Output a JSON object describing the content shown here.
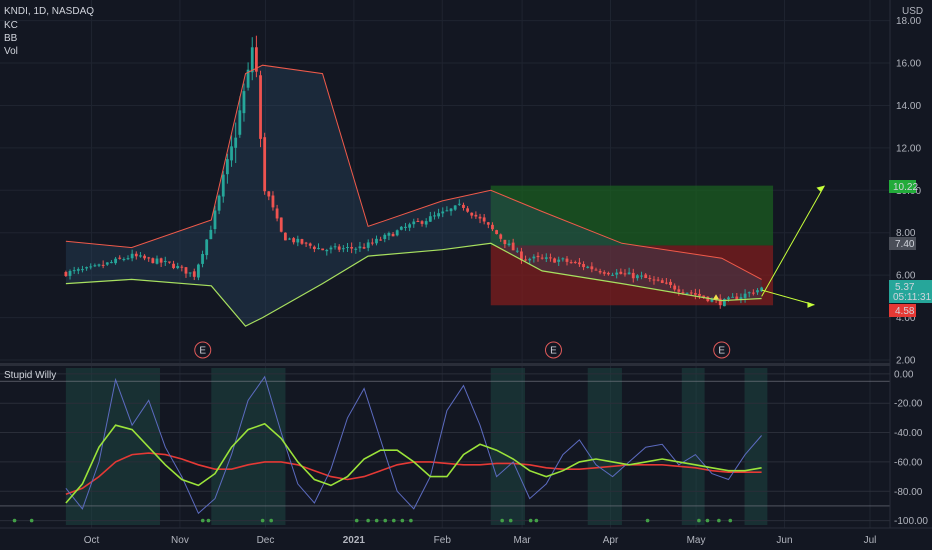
{
  "header": {
    "symbol_line": "KNDI, 1D, NASDAQ",
    "indicators": [
      "KC",
      "BB",
      "Vol"
    ],
    "currency": "USD"
  },
  "colors": {
    "background": "#131722",
    "up": "#26a69a",
    "down": "#ef5350",
    "upper_band": "#f05a4a",
    "lower_band": "#a8e05f",
    "profit_zone": "#1b5e20",
    "loss_zone": "#7f1d1d",
    "osc_line": "#5c6bc0",
    "osc_signal": "#9be33a",
    "osc_ma": "#e53935",
    "projection": "#c6ff3a"
  },
  "price_labels": {
    "target": "10.22",
    "entry": "7.40",
    "current": "5.37",
    "countdown": "05:11:31",
    "stop": "4.58"
  },
  "earnings_marker": "E",
  "oscillator": {
    "title": "Stupid Willy"
  },
  "chart_data": [
    {
      "type": "candlestick",
      "title": "KNDI, 1D, NASDAQ",
      "x_ticks": [
        "Oct",
        "Nov",
        "Dec",
        "2021",
        "Feb",
        "Mar",
        "Apr",
        "May",
        "Jun",
        "Jul"
      ],
      "y_ticks": [
        "2.00",
        "4.00",
        "6.00",
        "8.00",
        "10.00",
        "12.00",
        "14.00",
        "16.00",
        "18.00"
      ],
      "ylim": [
        2,
        18.5
      ],
      "key_points": [
        {
          "date": "Sep 22",
          "close": 6.1
        },
        {
          "date": "Oct 1",
          "close": 6.3
        },
        {
          "date": "Oct 15",
          "close": 6.9
        },
        {
          "date": "Oct 29",
          "close": 6.5
        },
        {
          "date": "Nov 6",
          "close": 6.0
        },
        {
          "date": "Nov 12",
          "close": 8.3
        },
        {
          "date": "Nov 19",
          "close": 11.8
        },
        {
          "date": "Nov 25",
          "close": 15.5
        },
        {
          "date": "Nov 27",
          "close": 17.4
        },
        {
          "date": "Nov 30",
          "close": 10.5
        },
        {
          "date": "Dec 7",
          "close": 7.8
        },
        {
          "date": "Dec 21",
          "close": 7.2
        },
        {
          "date": "Jan 4",
          "close": 7.3
        },
        {
          "date": "Jan 20",
          "close": 8.3
        },
        {
          "date": "Feb 1",
          "close": 8.9
        },
        {
          "date": "Feb 8",
          "close": 9.3
        },
        {
          "date": "Feb 18",
          "close": 8.2
        },
        {
          "date": "Mar 1",
          "close": 6.8
        },
        {
          "date": "Mar 15",
          "close": 6.7
        },
        {
          "date": "Mar 29",
          "close": 6.2
        },
        {
          "date": "Apr 12",
          "close": 5.9
        },
        {
          "date": "Apr 26",
          "close": 5.3
        },
        {
          "date": "May 10",
          "close": 4.7
        },
        {
          "date": "May 24",
          "close": 5.37
        }
      ],
      "upper_band": [
        {
          "date": "Sep 22",
          "value": 7.6
        },
        {
          "date": "Oct 15",
          "value": 7.3
        },
        {
          "date": "Nov 12",
          "value": 8.6
        },
        {
          "date": "Nov 24",
          "value": 15.5
        },
        {
          "date": "Nov 30",
          "value": 15.9
        },
        {
          "date": "Dec 21",
          "value": 15.5
        },
        {
          "date": "Jan 6",
          "value": 8.3
        },
        {
          "date": "Feb 1",
          "value": 9.5
        },
        {
          "date": "Feb 18",
          "value": 10.0
        },
        {
          "date": "Mar 8",
          "value": 9.0
        },
        {
          "date": "Apr 5",
          "value": 7.5
        },
        {
          "date": "May 10",
          "value": 6.8
        },
        {
          "date": "May 24",
          "value": 5.8
        }
      ],
      "lower_band": [
        {
          "date": "Sep 22",
          "value": 5.6
        },
        {
          "date": "Oct 15",
          "value": 5.8
        },
        {
          "date": "Nov 12",
          "value": 5.5
        },
        {
          "date": "Nov 24",
          "value": 3.6
        },
        {
          "date": "Nov 30",
          "value": 4.0
        },
        {
          "date": "Dec 21",
          "value": 5.6
        },
        {
          "date": "Jan 6",
          "value": 6.9
        },
        {
          "date": "Feb 1",
          "value": 7.2
        },
        {
          "date": "Feb 18",
          "value": 7.5
        },
        {
          "date": "Mar 8",
          "value": 6.2
        },
        {
          "date": "Apr 5",
          "value": 5.6
        },
        {
          "date": "May 10",
          "value": 4.8
        },
        {
          "date": "May 24",
          "value": 4.9
        }
      ],
      "zones": {
        "entry": 7.4,
        "target": 10.22,
        "stop": 4.58
      }
    },
    {
      "type": "line",
      "title": "Stupid Willy",
      "y_ticks": [
        "0.00",
        "-20.00",
        "-40.00",
        "-60.00",
        "-80.00",
        "-100.00"
      ],
      "ylim": [
        -103,
        4
      ],
      "series": [
        {
          "values": [
            -78,
            -92,
            -60,
            -4,
            -35,
            -18,
            -50,
            -70,
            -95,
            -85,
            -55,
            -18,
            -2,
            -40,
            -75,
            -88,
            -65,
            -30,
            -10,
            -45,
            -80,
            -92,
            -70,
            -25,
            -8,
            -35,
            -70,
            -60,
            -85,
            -75,
            -55,
            -45,
            -62,
            -70,
            -60,
            -50,
            -48,
            -62,
            -55,
            -68,
            -72,
            -55,
            -42
          ]
        },
        {
          "values": [
            -88,
            -75,
            -50,
            -35,
            -38,
            -50,
            -62,
            -72,
            -76,
            -68,
            -50,
            -38,
            -34,
            -44,
            -60,
            -72,
            -76,
            -70,
            -58,
            -52,
            -52,
            -60,
            -70,
            -70,
            -55,
            -48,
            -52,
            -58,
            -66,
            -70,
            -66,
            -60,
            -58,
            -60,
            -62,
            -60,
            -58,
            -60,
            -62,
            -64,
            -66,
            -66,
            -64
          ]
        },
        {
          "values": [
            -82,
            -78,
            -70,
            -60,
            -55,
            -54,
            -55,
            -58,
            -62,
            -65,
            -65,
            -62,
            -60,
            -60,
            -62,
            -66,
            -70,
            -72,
            -70,
            -66,
            -62,
            -60,
            -60,
            -61,
            -62,
            -62,
            -61,
            -61,
            -62,
            -64,
            -65,
            -65,
            -64,
            -63,
            -62,
            -62,
            -62,
            -63,
            -64,
            -66,
            -67,
            -67,
            -67
          ]
        }
      ]
    }
  ]
}
